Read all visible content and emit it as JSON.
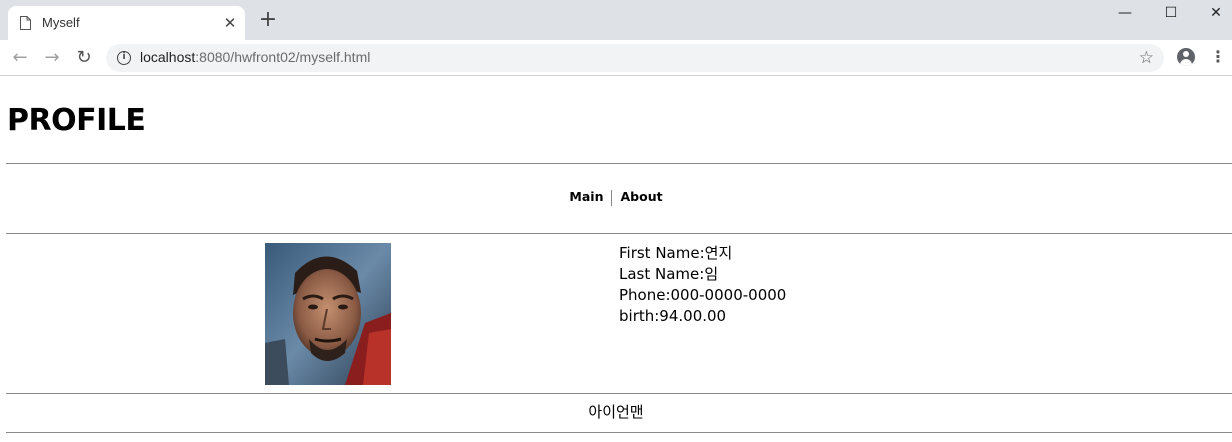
{
  "browser": {
    "tab_title": "Myself",
    "tab_close_glyph": "✕",
    "new_tab_glyph": "+",
    "window_controls": {
      "minimize": "—",
      "maximize": "☐",
      "close": "✕"
    },
    "nav": {
      "back": "←",
      "forward": "→",
      "reload": "↻"
    },
    "url_host": "localhost",
    "url_rest": ":8080/hwfront02/myself.html",
    "star_glyph": "☆",
    "menu_glyph": "⋮",
    "info_glyph": "i"
  },
  "page": {
    "title": "PROFILE",
    "nav": [
      {
        "label": "Main"
      },
      {
        "label": "About"
      }
    ],
    "profile": {
      "first_name": "First Name:연지",
      "last_name": "Last Name:임",
      "phone": "Phone:000-0000-0000",
      "birth": "birth:94.00.00"
    },
    "caption": "아이언맨"
  },
  "colors": {
    "tabstrip": "#dee1e6",
    "omnibox": "#f1f3f4",
    "divider": "#8a8a8a"
  },
  "icons": {
    "tab_favicon": "page-icon",
    "info": "info-icon",
    "bookmark": "star-icon",
    "account": "account-icon",
    "menu": "kebab-menu-icon"
  }
}
